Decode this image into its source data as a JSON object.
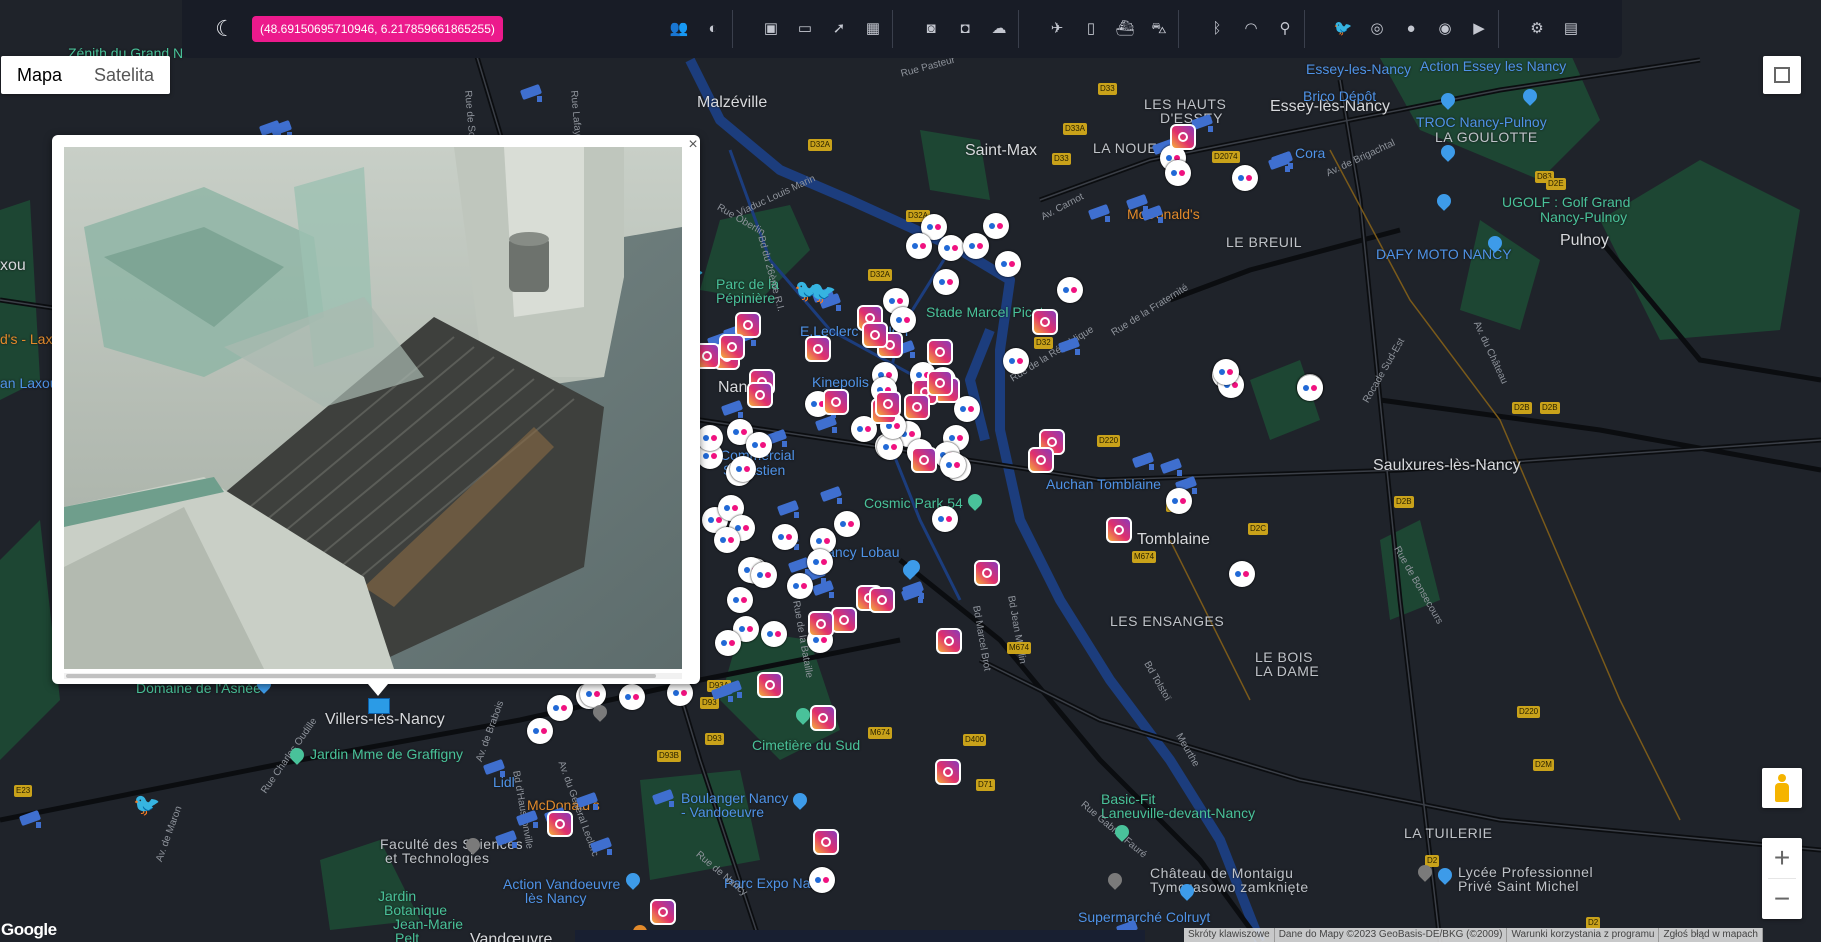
{
  "toolbar": {
    "theme_icon": "moon-icon",
    "coordinates": "(48.69150695710946, 6.217859661865255)",
    "groups": [
      [
        "people-icon",
        "mask-icon"
      ],
      [
        "video-icon",
        "monitor-icon",
        "share-icon",
        "building-icon"
      ],
      [
        "camera-icon",
        "camera-alt-icon",
        "cloud-icon"
      ],
      [
        "plane-icon",
        "train-icon",
        "ship-icon",
        "car-icon"
      ],
      [
        "bluetooth-icon",
        "wifi-icon",
        "antenna-icon"
      ],
      [
        "twitter-icon",
        "instagram-icon",
        "flickr-icon",
        "eye-icon",
        "youtube-icon"
      ],
      [
        "settings-icon",
        "map-icon"
      ]
    ]
  },
  "map_type": {
    "map": "Mapa",
    "satellite": "Satelita"
  },
  "places": [
    {
      "t": "Malzéville",
      "c": "place"
    },
    {
      "t": "Saint-Max",
      "c": "place"
    },
    {
      "t": "LES HAUTS",
      "c": "place-sm"
    },
    {
      "t": "D'ESSEY",
      "c": "place-sm"
    },
    {
      "t": "Essey-lès-Nancy",
      "c": "place"
    },
    {
      "t": "LA NOUE",
      "c": "place-sm"
    },
    {
      "t": "LA GOULOTTE",
      "c": "place-sm"
    },
    {
      "t": "LE BREUIL",
      "c": "place-sm"
    },
    {
      "t": "Pulnoy",
      "c": "place"
    },
    {
      "t": "Saulxures-lès-Nancy",
      "c": "place"
    },
    {
      "t": "Tomblaine",
      "c": "place"
    },
    {
      "t": "LES ENSANGES",
      "c": "place-sm"
    },
    {
      "t": "LE BOIS",
      "c": "place-sm"
    },
    {
      "t": "LA DAME",
      "c": "place-sm"
    },
    {
      "t": "LA TUILERIE",
      "c": "place-sm"
    },
    {
      "t": "Villers-lès-Nancy",
      "c": "place"
    },
    {
      "t": "Vandœuvre",
      "c": "place"
    },
    {
      "t": "Nan",
      "c": "place"
    }
  ],
  "pois": [
    {
      "t": "Zénith du Grand N",
      "c": "poi-g"
    },
    {
      "t": "Action Essey les Nancy",
      "c": "poi"
    },
    {
      "t": "Essey-les-Nancy",
      "c": "poi"
    },
    {
      "t": "Brico Dépôt",
      "c": "poi"
    },
    {
      "t": "TROC Nancy-Pulnoy",
      "c": "poi"
    },
    {
      "t": "Cora",
      "c": "poi"
    },
    {
      "t": "UGOLF : Golf Grand",
      "c": "poi-g"
    },
    {
      "t": "Nancy-Pulnoy",
      "c": "poi-g"
    },
    {
      "t": "DAFY MOTO NANCY",
      "c": "poi"
    },
    {
      "t": "McDonald's",
      "c": "poi-o"
    },
    {
      "t": "Parc de la",
      "c": "poi-g"
    },
    {
      "t": "Pépinière",
      "c": "poi-g"
    },
    {
      "t": "E.Leclerc NANCY",
      "c": "poi"
    },
    {
      "t": "Stade Marcel Picot",
      "c": "poi-g"
    },
    {
      "t": "Kinepolis",
      "c": "poi"
    },
    {
      "t": "Commercial",
      "c": "poi"
    },
    {
      "t": "Sébastien",
      "c": "poi"
    },
    {
      "t": "Cosmic Park 54",
      "c": "poi-g"
    },
    {
      "t": "Auchan Tomblaine",
      "c": "poi"
    },
    {
      "t": "Nancy Lobau",
      "c": "poi"
    },
    {
      "t": "Domaine de l'Asnée",
      "c": "poi-g"
    },
    {
      "t": "Cimetière du Sud",
      "c": "poi-g"
    },
    {
      "t": "Jardin Mme de Graffigny",
      "c": "poi-g"
    },
    {
      "t": "Lidl",
      "c": "poi"
    },
    {
      "t": "Boulanger Nancy",
      "c": "poi"
    },
    {
      "t": "- Vandoeuvre",
      "c": "poi"
    },
    {
      "t": "McDonald's",
      "c": "poi-o"
    },
    {
      "t": "Faculté des Sciences",
      "c": "place-sm"
    },
    {
      "t": "et Technologies",
      "c": "place-sm"
    },
    {
      "t": "Jardin",
      "c": "poi-g"
    },
    {
      "t": "Botanique",
      "c": "poi-g"
    },
    {
      "t": "Jean-Marie",
      "c": "poi-g"
    },
    {
      "t": "Pelt",
      "c": "poi-g"
    },
    {
      "t": "Action Vandoeuvre",
      "c": "poi"
    },
    {
      "t": "lès Nancy",
      "c": "poi"
    },
    {
      "t": "Parc Expo Nancy",
      "c": "poi"
    },
    {
      "t": "Basic-Fit",
      "c": "poi-g"
    },
    {
      "t": "Laneuville-devant-Nancy",
      "c": "poi-g"
    },
    {
      "t": "Château de Montaigu",
      "c": "place-sm"
    },
    {
      "t": "Tymczasowo zamknięte",
      "c": "place-sm"
    },
    {
      "t": "Supermarché Colruyt",
      "c": "poi"
    },
    {
      "t": "Lycée Professionnel",
      "c": "place-sm"
    },
    {
      "t": "Privé Saint Michel",
      "c": "place-sm"
    },
    {
      "t": "d's - Lax",
      "c": "poi-o"
    },
    {
      "t": "an Laxou",
      "c": "poi"
    },
    {
      "t": "xou",
      "c": "place"
    }
  ],
  "roads": [
    "Rue Oberlin",
    "Viaduc Louis Marin",
    "Bd du 26ème R.I.",
    "Av. Carnot",
    "Rue de la Fraternité",
    "Rue de la République",
    "Rocade Sud-Est",
    "Av. du Château",
    "Av. de Brigachtal",
    "Bd Marcel Brot",
    "Bd Jean Moulin",
    "Bd Tolstoï",
    "Rue Gabriel Fauré",
    "Rue de Bonsecours",
    "Meurthe",
    "Rue de Scarpone",
    "Rue Lafayette",
    "Rue Pasteur",
    "Av. de Brabois",
    "Rue Charles Oudille",
    "Av. de Maron",
    "Av. du Général Leclerc",
    "Rue de Nancy",
    "Bd d'Haussonville",
    "Rue de la Bataille"
  ],
  "shields": [
    "D32A",
    "D33",
    "D33A",
    "D2074",
    "D83",
    "D2E",
    "D32A",
    "D32",
    "D220",
    "D2B",
    "D2B",
    "D2B",
    "D2C",
    "D220",
    "D2M",
    "D2",
    "D2",
    "M674",
    "M674",
    "M674",
    "D400",
    "D71",
    "D93A",
    "D93",
    "D93B",
    "D93",
    "E23",
    "D32A",
    "D2B",
    "D33"
  ],
  "popup": {
    "close_icon": "close-icon",
    "image": "webcam-canal-lock-image"
  },
  "controls": {
    "zoom_in": "+",
    "zoom_out": "−",
    "fullscreen_icon": "fullscreen-icon",
    "pegman_icon": "pegman-icon"
  },
  "footer": {
    "logo": "Google",
    "attribution": [
      "Skróty klawiszowe",
      "Dane do Mapy ©2023 GeoBasis-DE/BKG (©2009)",
      "Warunki korzystania z programu",
      "Zgłoś błąd w mapach"
    ]
  },
  "colors": {
    "coord_badge": "#ec1a8c",
    "toolbar_bg": "#181c26",
    "map_bg": "#1f232a",
    "river": "#1c3d7d",
    "park": "#1d4a34"
  }
}
